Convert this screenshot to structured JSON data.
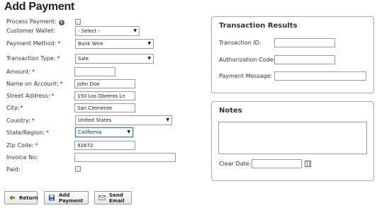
{
  "page": {
    "title": "Add Payment"
  },
  "form": {
    "process_payment": {
      "label": "Process Payment:"
    },
    "customer_wallet": {
      "label": "Customer Wallet:",
      "value": "- Select -"
    },
    "payment_method": {
      "label": "Payment Method:",
      "value": "Bank Wire"
    },
    "transaction_type": {
      "label": "Transaction Type:",
      "value": "Sale"
    },
    "amount": {
      "label": "Amount:",
      "value": ""
    },
    "name_on_account": {
      "label": "Name on Account:",
      "value": "John Doe"
    },
    "street_address": {
      "label": "Street Address:",
      "value": "150 Los Obreros Ln"
    },
    "city": {
      "label": "City:",
      "value": "San Clemente"
    },
    "country": {
      "label": "Country:",
      "value": "United States"
    },
    "state_region": {
      "label": "State/Region:",
      "value": "California"
    },
    "zip_code": {
      "label": "Zip Code:",
      "value": "92672"
    },
    "invoice_no": {
      "label": "Invoice No:",
      "value": ""
    },
    "paid": {
      "label": "Paid:"
    },
    "required_mark": "*"
  },
  "transaction_results": {
    "title": "Transaction Results",
    "transaction_id": {
      "label": "Transaction ID:",
      "value": ""
    },
    "authorization_code": {
      "label": "Authorization Code:",
      "value": ""
    },
    "payment_message": {
      "label": "Payment Message:",
      "value": ""
    }
  },
  "notes": {
    "title": "Notes",
    "text": "",
    "clear_date": {
      "label": "Clear Date:",
      "value": ""
    }
  },
  "buttons": {
    "return": "Return",
    "add_payment": "Add Payment",
    "send_email": "Send Email"
  },
  "icons": {
    "info": "info-icon",
    "return": "arrow-left-icon",
    "add_payment": "save-icon",
    "send_email": "email-icon",
    "calendar": "calendar-icon"
  },
  "colors": {
    "required": "#cc0000",
    "focus_border": "#3c7fc1"
  }
}
